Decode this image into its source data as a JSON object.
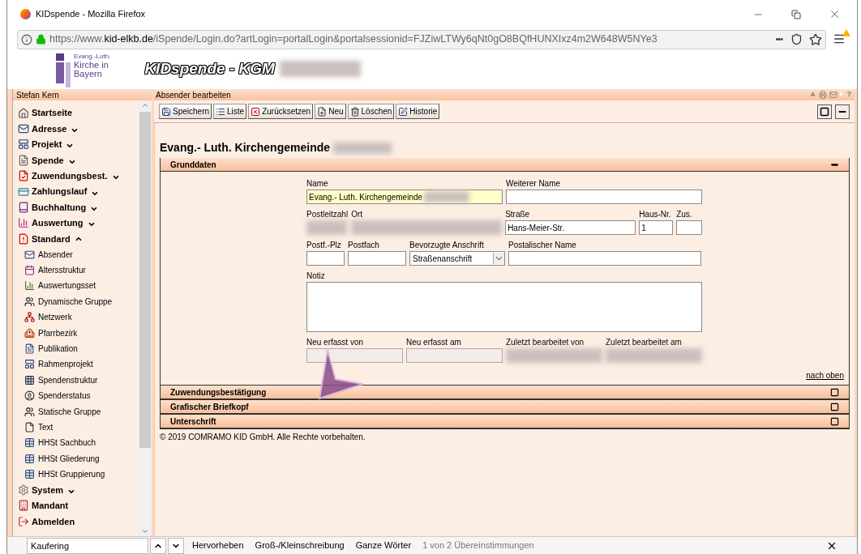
{
  "browser": {
    "title": "KIDspende - Mozilla Firefox",
    "url": {
      "prefix": "https://www.",
      "domain": "kid-elkb.de",
      "path": "/iSpende/Login.do?artLogin=portalLogin&portalsessionid=FJZiwLTWy6qNt0gO8BQfHUNXIxz4m2W648W5NYe3"
    },
    "more": "•••"
  },
  "banner": {
    "logo_lines": [
      "Evang.-Luth.",
      "Kirche in",
      "Bayern"
    ],
    "title": "KIDspende - KGM",
    "redacted": true
  },
  "user": "Stefan Kern",
  "sidebar": {
    "items": [
      {
        "label": "Startseite",
        "kind": "group"
      },
      {
        "label": "Adresse",
        "kind": "group",
        "expanded": false
      },
      {
        "label": "Projekt",
        "kind": "group",
        "expanded": false
      },
      {
        "label": "Spende",
        "kind": "group",
        "expanded": false
      },
      {
        "label": "Zuwendungsbest.",
        "kind": "group",
        "expanded": false
      },
      {
        "label": "Zahlungslauf",
        "kind": "group",
        "expanded": false
      },
      {
        "label": "Buchhaltung",
        "kind": "group",
        "expanded": false
      },
      {
        "label": "Auswertung",
        "kind": "group",
        "expanded": false
      },
      {
        "label": "Standard",
        "kind": "group",
        "expanded": true,
        "children": [
          {
            "label": "Absender"
          },
          {
            "label": "Altersstruktur"
          },
          {
            "label": "Auswertungsset"
          },
          {
            "label": "Dynamische Gruppe"
          },
          {
            "label": "Netzwerk"
          },
          {
            "label": "Pfarrbezirk"
          },
          {
            "label": "Publikation"
          },
          {
            "label": "Rahmenprojekt"
          },
          {
            "label": "Spendenstruktur"
          },
          {
            "label": "Spenderstatus"
          },
          {
            "label": "Statische Gruppe"
          },
          {
            "label": "Text"
          },
          {
            "label": "HHSt Sachbuch"
          },
          {
            "label": "HHSt Gliederung"
          },
          {
            "label": "HHSt Gruppierung"
          }
        ]
      },
      {
        "label": "System",
        "kind": "group",
        "expanded": false
      },
      {
        "label": "Mandant",
        "kind": "group"
      },
      {
        "label": "Abmelden",
        "kind": "group"
      }
    ]
  },
  "page": {
    "title": "Absender bearbeiten",
    "toolbar": [
      "Speichern",
      "Liste",
      "Zurücksetzen",
      "Neu",
      "Löschen",
      "Historie"
    ],
    "side_icons": [
      "A",
      "F",
      "?"
    ],
    "heading": "Evang.- Luth. Kirchengemeinde",
    "heading_redacted": true,
    "sections": [
      {
        "title": "Grunddaten",
        "expanded": true
      },
      {
        "title": "Zuwendungsbestätigung",
        "expanded": false
      },
      {
        "title": "Grafischer Briefkopf",
        "expanded": false
      },
      {
        "title": "Unterschrift",
        "expanded": false
      }
    ],
    "form_rows": [
      [
        {
          "label": "Name",
          "kind": "text",
          "value": "Evang.- Luth. Kirchengemeinde",
          "highlighted": true,
          "redacted": true
        },
        {
          "label": "Weiterer Name",
          "kind": "text"
        }
      ],
      [
        {
          "label": "Postleitzahl",
          "kind": "text",
          "redacted": true
        },
        {
          "label": "Ort",
          "kind": "text",
          "redacted": true
        },
        {
          "label": "Straße",
          "kind": "text",
          "value": "Hans-Meier-Str."
        },
        {
          "label": "Haus-Nr.",
          "kind": "text",
          "value": "1"
        },
        {
          "label": "Zus.",
          "kind": "text"
        }
      ],
      [
        {
          "label": "Postf.-Plz",
          "kind": "text"
        },
        {
          "label": "Postfach",
          "kind": "text"
        },
        {
          "label": "Bevorzugte Anschrift",
          "kind": "select",
          "value": "Straßenanschrift"
        },
        {
          "label": "Postalischer Name",
          "kind": "text"
        }
      ],
      [
        {
          "label": "Notiz",
          "kind": "textarea"
        }
      ],
      [
        {
          "label": "Neu erfasst von",
          "kind": "readonly"
        },
        {
          "label": "Neu erfasst am",
          "kind": "readonly"
        },
        {
          "label": "Zuletzt bearbeitet von",
          "kind": "readonly",
          "redacted": true
        },
        {
          "label": "Zuletzt bearbeitet am",
          "kind": "readonly",
          "redacted": true
        }
      ]
    ],
    "top_link": "nach oben",
    "copyright": "© 2019 COMRAMO KID GmbH. Alle Rechte vorbehalten."
  },
  "findbar": {
    "value": "Kaufering",
    "options": [
      "Hervorheben",
      "Groß-/Kleinschreibung",
      "Ganze Wörter"
    ],
    "status": "1 von 2 Übereinstimmungen"
  }
}
